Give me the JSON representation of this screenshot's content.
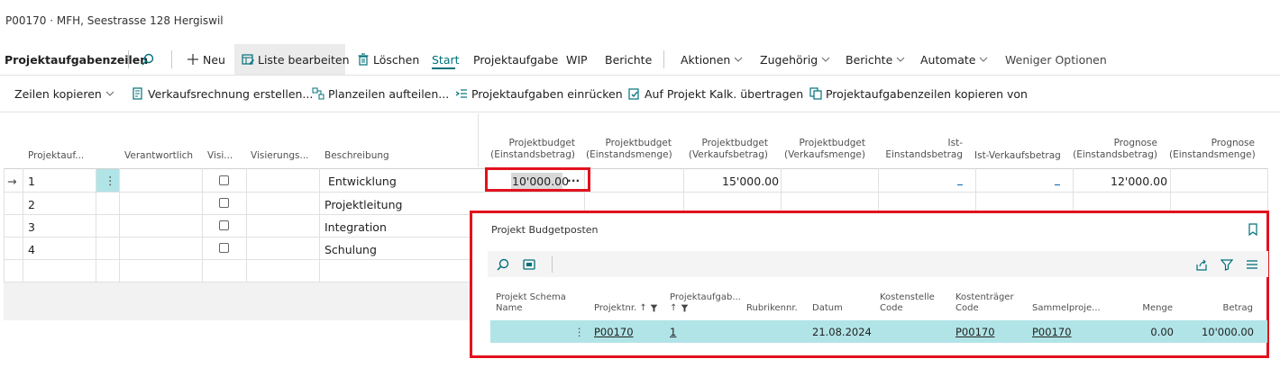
{
  "header": {
    "title": "P00170 · MFH, Seestrasse 128 Hergiswil"
  },
  "action_bar": {
    "page_name": "Projektaufgabenzeilen",
    "new_label": "Neu",
    "edit_list_label": "Liste bearbeiten",
    "delete_label": "Löschen",
    "tabs": [
      "Start",
      "Projektaufgabe",
      "WIP",
      "Berichte"
    ],
    "menus": [
      "Aktionen",
      "Zugehörig",
      "Berichte",
      "Automate"
    ],
    "fewer_options": "Weniger Optionen"
  },
  "sub_bar": {
    "copy_lines": "Zeilen kopieren",
    "create_invoice": "Verkaufsrechnung erstellen...",
    "split_lines": "Planzeilen aufteilen...",
    "indent": "Projektaufgaben einrücken",
    "transfer": "Auf Projekt Kalk. übertragen",
    "copy_from": "Projektaufgabenzeilen kopieren von"
  },
  "grid": {
    "headers": {
      "task_no": "Projektauf...",
      "responsible": "Verantwortlich",
      "vis": "Visi...",
      "visierung": "Visierungs...",
      "description": "Beschreibung",
      "budget_cost_1": "Projektbudget",
      "budget_cost_2": "(Einstandsbetrag)",
      "budget_qty_1": "Projektbudget",
      "budget_qty_2": "(Einstandsmenge)",
      "budget_sales_1": "Projektbudget",
      "budget_sales_2": "(Verkaufsbetrag)",
      "budget_salesqty_1": "Projektbudget",
      "budget_salesqty_2": "(Verkaufsmenge)",
      "actual_cost_1": "Ist-",
      "actual_cost_2": "Einstandsbetrag",
      "actual_sales": "Ist-Verkaufsbetrag",
      "forecast_cost_1": "Prognose",
      "forecast_cost_2": "(Einstandsbetrag)",
      "forecast_sales_1": "Prognose",
      "forecast_sales_2": "(Einstandsmenge)"
    },
    "rows": [
      {
        "no": "1",
        "description": "Entwicklung",
        "budget_cost": "10'000.00",
        "budget_sales": "15'000.00",
        "forecast": "12'000.00"
      },
      {
        "no": "2",
        "description": "Projektleitung"
      },
      {
        "no": "3",
        "description": "Integration"
      },
      {
        "no": "4",
        "description": "Schulung"
      }
    ],
    "current_row_marker": "→",
    "more_glyph": "···",
    "row_menu_glyph": "⋮"
  },
  "factbox": {
    "title": "Projekt Budgetposten",
    "headers": {
      "schema_1": "Projekt Schema",
      "schema_2": "Name",
      "projekt_nr": "Projektnr. ↑",
      "aufgabe_1": "Projektaufgab...",
      "aufgabe_2": "↑",
      "rubrik": "Rubrikennr.",
      "datum": "Datum",
      "kst_1": "Kostenstelle",
      "kst_2": "Code",
      "ktr_1": "Kostenträger",
      "ktr_2": "Code",
      "sammel": "Sammelproje...",
      "menge": "Menge",
      "betrag": "Betrag"
    },
    "row": {
      "projekt_nr": "P00170",
      "aufgabe": "1",
      "datum": "21.08.2024",
      "ktr": "P00170",
      "sammel": "P00170",
      "menge": "0.00",
      "betrag": "10'000.00"
    }
  },
  "colors": {
    "accent": "#00707a",
    "highlight": "#e3111e",
    "selected_row": "#b1e4e7",
    "link": "#0067b8"
  }
}
